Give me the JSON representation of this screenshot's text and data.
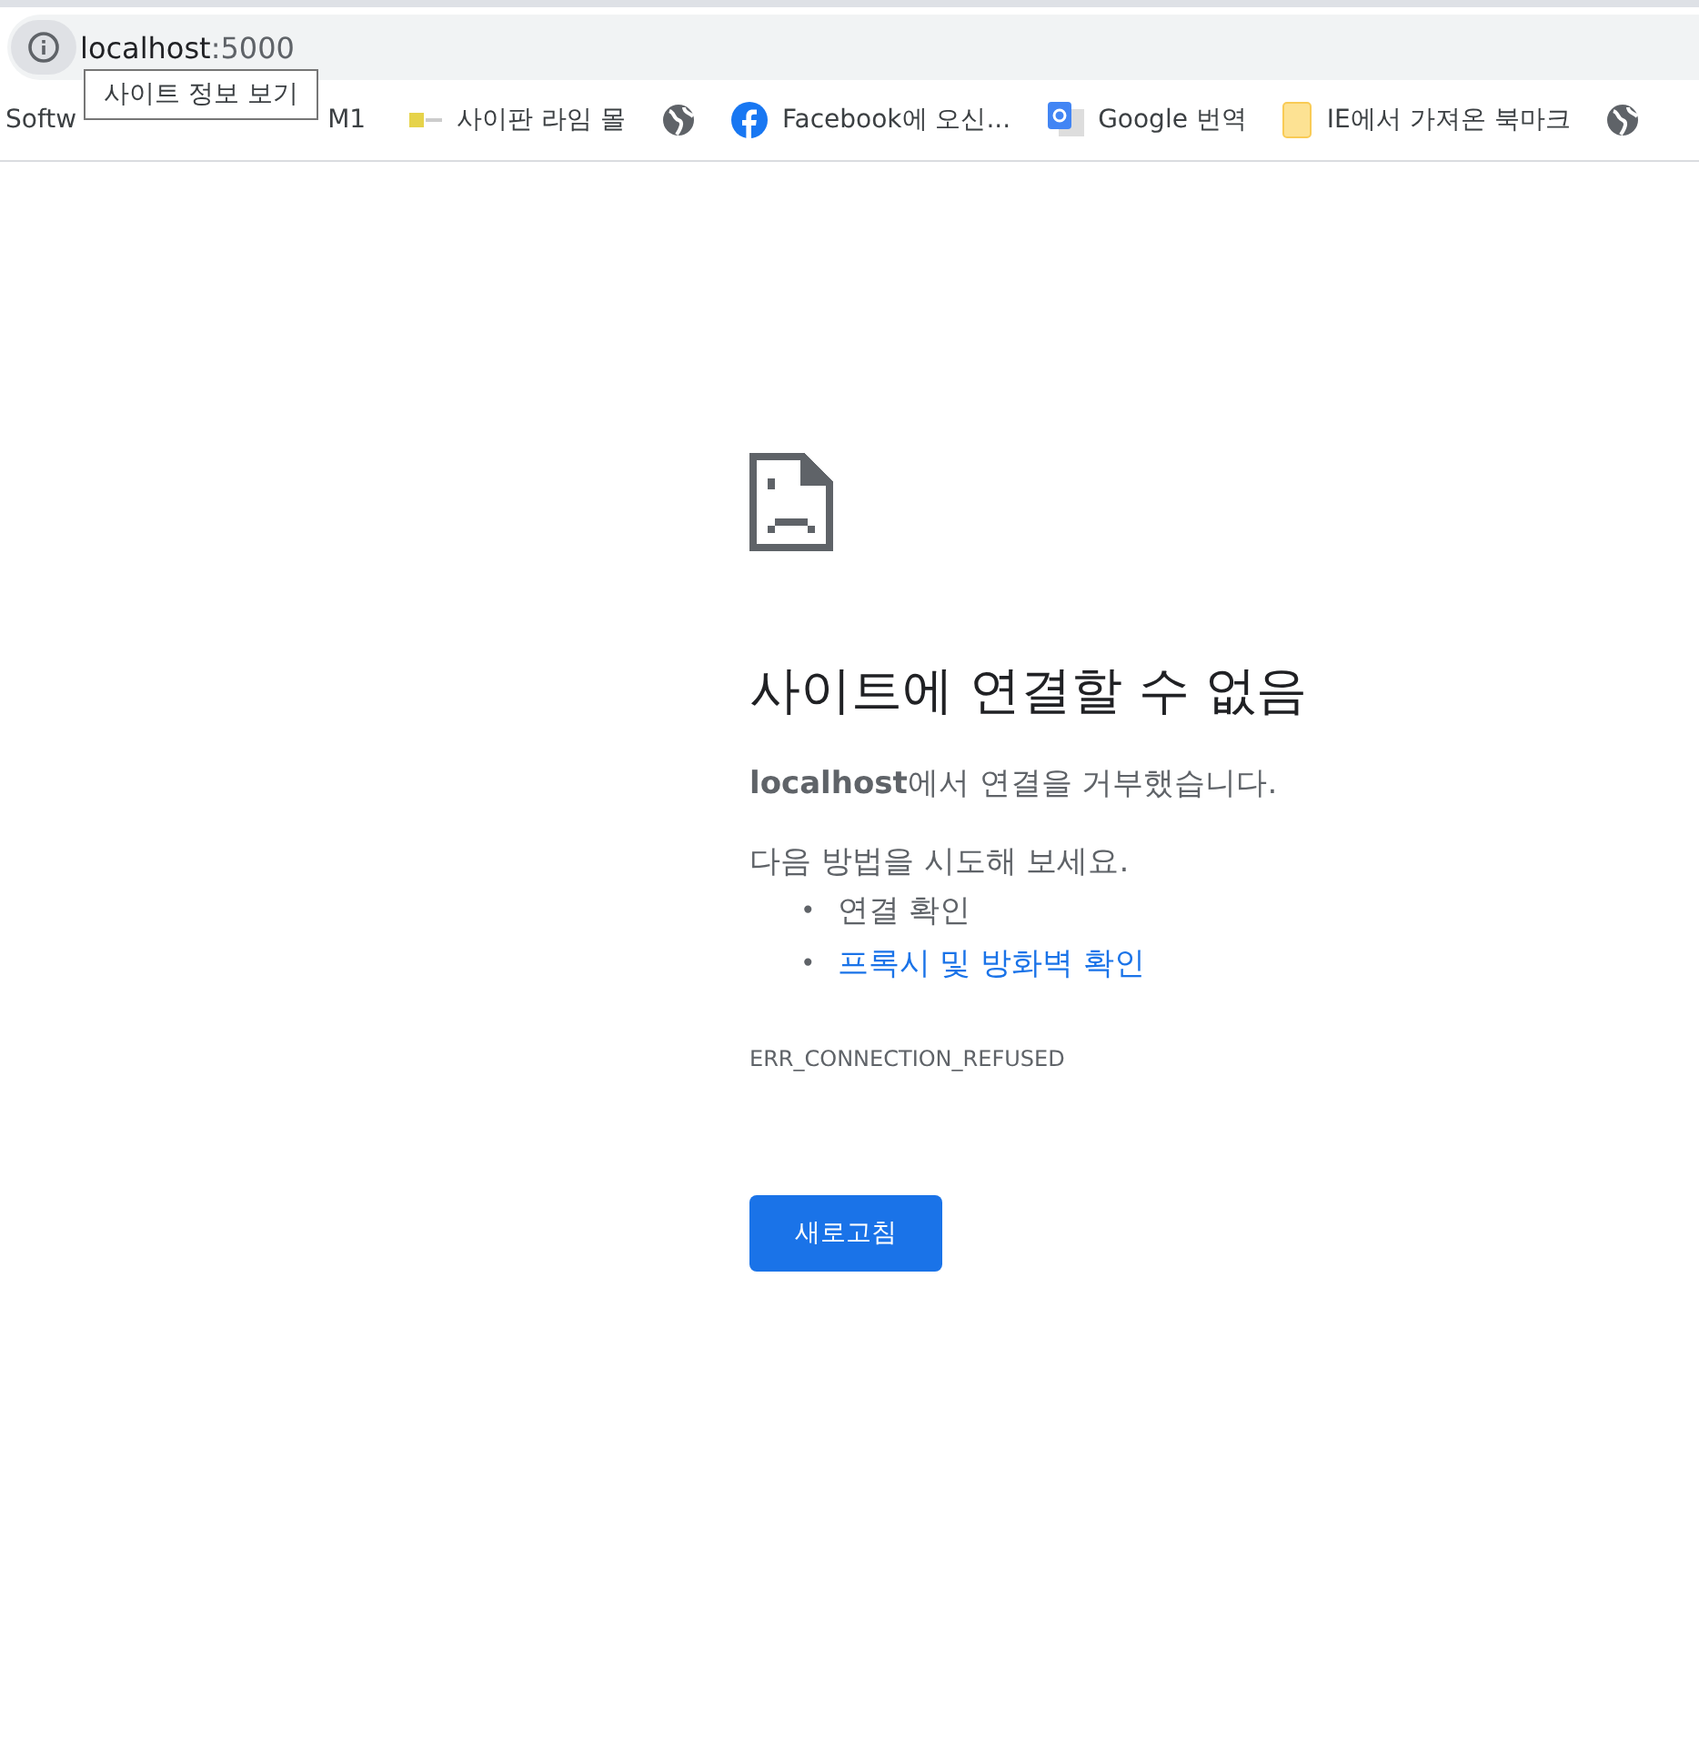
{
  "address_bar": {
    "url_host": "localhost",
    "url_port": ":5000"
  },
  "tooltip": {
    "text": "사이트 정보 보기"
  },
  "bookmarks": [
    {
      "kind": "text",
      "label": "Softw"
    },
    {
      "kind": "text",
      "label": "M1"
    },
    {
      "kind": "thumb",
      "label": "사이판 라임 몰"
    },
    {
      "kind": "globe"
    },
    {
      "kind": "facebook",
      "label": "Facebook에 오신..."
    },
    {
      "kind": "translate",
      "label": "Google 번역"
    },
    {
      "kind": "folder",
      "label": "IE에서 가져온 북마크"
    },
    {
      "kind": "globe"
    }
  ],
  "error": {
    "title": "사이트에 연결할 수 없음",
    "message": "**localhost**에서 연결을 거부했습니다.",
    "suggestions_heading": "다음 방법을 시도해 보세요.",
    "suggestions": [
      {
        "bullet": "•",
        "text": "연결 확인",
        "kind": "text"
      },
      {
        "bullet": "•",
        "text": "프록시 및 방화벽 확인",
        "kind": "link"
      }
    ],
    "code": "ERR_CONNECTION_REFUSED",
    "button": "새로고침"
  }
}
